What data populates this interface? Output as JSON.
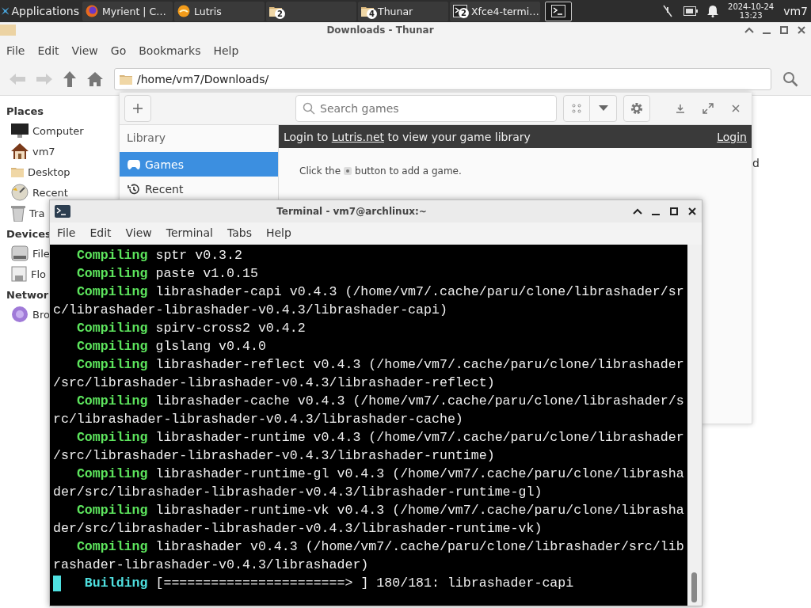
{
  "taskbar": {
    "app_menu": "Applications",
    "tasks": [
      {
        "kind": "browser",
        "label": "Myrient | C…",
        "selected": false
      },
      {
        "kind": "lutris",
        "label": "Lutris",
        "selected": false
      },
      {
        "kind": "folder",
        "count": "2",
        "selected": false
      },
      {
        "kind": "folder",
        "label": "Thunar",
        "count": "4",
        "selected": false
      },
      {
        "kind": "terminal",
        "label": "Xfce4-termi…",
        "count": "2",
        "selected": false
      },
      {
        "kind": "terminal",
        "selected": true
      }
    ],
    "date": "2024-10-24",
    "time": "13:23",
    "user": "vm7"
  },
  "thunar": {
    "title": "Downloads - Thunar",
    "menu": [
      "File",
      "Edit",
      "View",
      "Go",
      "Bookmarks",
      "Help"
    ],
    "path": "/home/vm7/Downloads/",
    "sidebar": [
      {
        "heading": "Places",
        "items": [
          {
            "kind": "computer",
            "label": "Computer"
          },
          {
            "kind": "home",
            "label": "vm7"
          },
          {
            "kind": "folder",
            "label": "Desktop"
          },
          {
            "kind": "recent",
            "label": "Recent"
          },
          {
            "kind": "trash",
            "label": "Tra"
          }
        ]
      },
      {
        "heading": "Devices",
        "items": [
          {
            "kind": "drive",
            "label": "File"
          },
          {
            "kind": "floppy",
            "label": "Flo"
          }
        ]
      },
      {
        "heading": "Networ",
        "items": [
          {
            "kind": "network",
            "label": "Bro"
          }
        ]
      }
    ],
    "file_label": "d"
  },
  "lutris": {
    "search": {
      "placeholder": "Search games"
    },
    "library_heading": "Library",
    "sidebar": [
      {
        "kind": "games",
        "label": "Games",
        "selected": true
      },
      {
        "kind": "recent",
        "label": "Recent",
        "selected": false
      }
    ],
    "banner": {
      "prefix": "Login to ",
      "link": "Lutris.net",
      "suffix": " to view your game library",
      "action": "Login"
    },
    "hint": {
      "before": "Click the",
      "after": "button to add a game."
    }
  },
  "terminal": {
    "title": "Terminal - vm7@archlinux:~",
    "menu": [
      "File",
      "Edit",
      "View",
      "Terminal",
      "Tabs",
      "Help"
    ],
    "lines": [
      {
        "kind": "status",
        "status": "Compiling",
        "text": "sptr v0.3.2"
      },
      {
        "kind": "status",
        "status": "Compiling",
        "text": "paste v1.0.15"
      },
      {
        "kind": "status",
        "status": "Compiling",
        "text": "librashader-capi v0.4.3 (/home/vm7/.cache/paru/clone/librashader/sr"
      },
      {
        "kind": "continuation",
        "text": "c/librashader-librashader-v0.4.3/librashader-capi)"
      },
      {
        "kind": "status",
        "status": "Compiling",
        "text": "spirv-cross2 v0.4.2"
      },
      {
        "kind": "status",
        "status": "Compiling",
        "text": "glslang v0.4.0"
      },
      {
        "kind": "status",
        "status": "Compiling",
        "text": "librashader-reflect v0.4.3 (/home/vm7/.cache/paru/clone/librashader"
      },
      {
        "kind": "continuation",
        "text": "/src/librashader-librashader-v0.4.3/librashader-reflect)"
      },
      {
        "kind": "status",
        "status": "Compiling",
        "text": "librashader-cache v0.4.3 (/home/vm7/.cache/paru/clone/librashader/s"
      },
      {
        "kind": "continuation",
        "text": "rc/librashader-librashader-v0.4.3/librashader-cache)"
      },
      {
        "kind": "status",
        "status": "Compiling",
        "text": "librashader-runtime v0.4.3 (/home/vm7/.cache/paru/clone/librashader"
      },
      {
        "kind": "continuation",
        "text": "/src/librashader-librashader-v0.4.3/librashader-runtime)"
      },
      {
        "kind": "status",
        "status": "Compiling",
        "text": "librashader-runtime-gl v0.4.3 (/home/vm7/.cache/paru/clone/librasha"
      },
      {
        "kind": "continuation",
        "text": "der/src/librashader-librashader-v0.4.3/librashader-runtime-gl)"
      },
      {
        "kind": "status",
        "status": "Compiling",
        "text": "librashader-runtime-vk v0.4.3 (/home/vm7/.cache/paru/clone/librasha"
      },
      {
        "kind": "continuation",
        "text": "der/src/librashader-librashader-v0.4.3/librashader-runtime-vk)"
      },
      {
        "kind": "status",
        "status": "Compiling",
        "text": "librashader v0.4.3 (/home/vm7/.cache/paru/clone/librashader/src/lib"
      },
      {
        "kind": "continuation",
        "text": "rashader-librashader-v0.4.3/librashader)"
      },
      {
        "kind": "progress",
        "status": "Building",
        "text": "[=======================> ] 180/181: librashader-capi"
      }
    ]
  }
}
